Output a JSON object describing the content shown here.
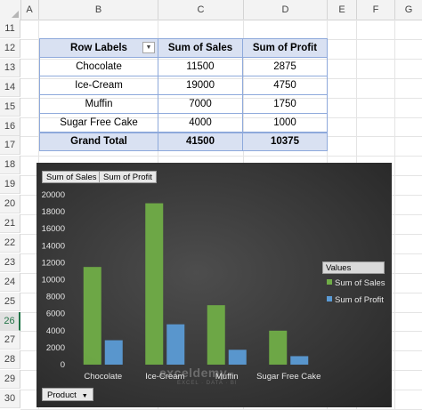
{
  "spreadsheet": {
    "columns": [
      "A",
      "B",
      "C",
      "D",
      "E",
      "F",
      "G"
    ],
    "rows": [
      "11",
      "12",
      "13",
      "14",
      "15",
      "16",
      "17",
      "18",
      "19",
      "20",
      "21",
      "22",
      "23",
      "24",
      "25",
      "26",
      "27",
      "28",
      "29",
      "30"
    ],
    "active_row": "26"
  },
  "pivot_table": {
    "headers": [
      "Row Labels",
      "Sum of Sales",
      "Sum of Profit"
    ],
    "rows": [
      {
        "label": "Chocolate",
        "sales": "11500",
        "profit": "2875"
      },
      {
        "label": "Ice-Cream",
        "sales": "19000",
        "profit": "4750"
      },
      {
        "label": "Muffin",
        "sales": "7000",
        "profit": "1750"
      },
      {
        "label": "Sugar Free Cake",
        "sales": "4000",
        "profit": "1000"
      }
    ],
    "total": {
      "label": "Grand Total",
      "sales": "41500",
      "profit": "10375"
    }
  },
  "pivot_chart": {
    "field_buttons": [
      "Sum of Sales",
      "Sum of Profit"
    ],
    "legend_title": "Values",
    "axis_field_button": "Product",
    "watermark": "exceldemy",
    "watermark_sub": "EXCEL · DATA · BI",
    "colors": {
      "sales": "#70ad47",
      "profit": "#5b9bd5"
    }
  },
  "chart_data": {
    "type": "bar",
    "categories": [
      "Chocolate",
      "Ice-Cream",
      "Muffin",
      "Sugar Free Cake"
    ],
    "series": [
      {
        "name": "Sum of Sales",
        "values": [
          11500,
          19000,
          7000,
          4000
        ]
      },
      {
        "name": "Sum of Profit",
        "values": [
          2875,
          4750,
          1750,
          1000
        ]
      }
    ],
    "yticks": [
      "0",
      "2000",
      "4000",
      "6000",
      "8000",
      "10000",
      "12000",
      "14000",
      "16000",
      "18000",
      "20000"
    ],
    "ylim": [
      0,
      20000
    ],
    "legend": "right"
  }
}
